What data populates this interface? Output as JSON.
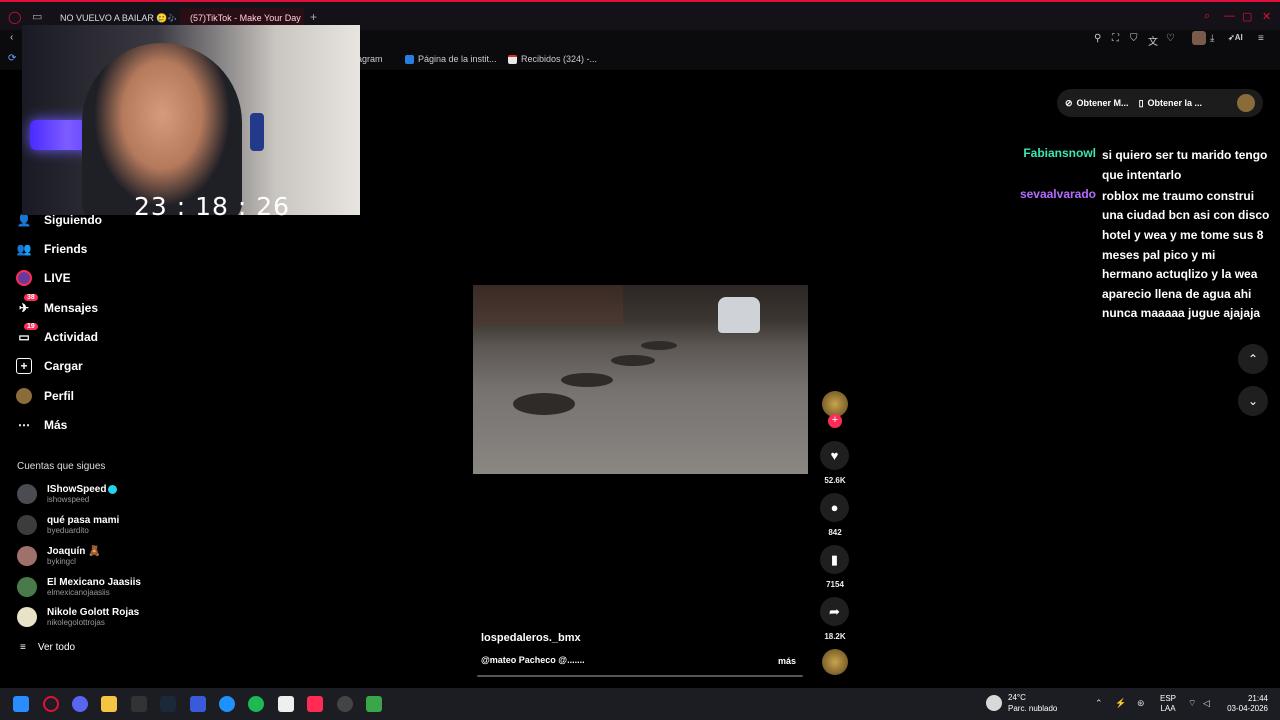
{
  "browser": {
    "tabs": [
      {
        "label": "NO VUELVO A BAILAR 🥲🎶",
        "active": false,
        "icon": "youtube-icon"
      },
      {
        "label": "(57)TikTok - Make Your Day",
        "active": true,
        "icon": "tiktok-icon"
      }
    ],
    "new_tab": "+",
    "bookmarks": [
      {
        "label": "nstagram",
        "icon": "instagram-icon"
      },
      {
        "label": "Página de la instit...",
        "icon": "page-icon"
      },
      {
        "label": "Recibidos (324) -...",
        "icon": "gmail-icon"
      }
    ],
    "toolbar_ai": "AI",
    "accent": "#e0103a"
  },
  "stream": {
    "timer": "23 : 18 : 26"
  },
  "sidebar": {
    "items": [
      {
        "label": "Siguiendo",
        "icon": "following-icon",
        "badge": ""
      },
      {
        "label": "Friends",
        "icon": "friends-icon",
        "badge": ""
      },
      {
        "label": "LIVE",
        "icon": "live-icon",
        "badge": ""
      },
      {
        "label": "Mensajes",
        "icon": "messages-icon",
        "badge": "38"
      },
      {
        "label": "Actividad",
        "icon": "activity-icon",
        "badge": "19"
      },
      {
        "label": "Cargar",
        "icon": "upload-icon",
        "badge": ""
      },
      {
        "label": "Perfil",
        "icon": "profile-icon",
        "badge": ""
      },
      {
        "label": "Más",
        "icon": "more-icon",
        "badge": ""
      }
    ],
    "following_title": "Cuentas que sigues",
    "accounts": [
      {
        "name": "IShowSpeed",
        "user": "ishowspeed",
        "verified": true
      },
      {
        "name": "qué pasa mami",
        "user": "byeduardito",
        "verified": false
      },
      {
        "name": "Joaquín 🧸",
        "user": "bykingcl",
        "verified": false
      },
      {
        "name": "El Mexicano Jaasiis",
        "user": "elmexicanojaasiis",
        "verified": false
      },
      {
        "name": "Nikole Golott Rojas",
        "user": "nikolegolottrojas",
        "verified": false
      }
    ],
    "see_all": "Ver todo"
  },
  "top_buttons": {
    "get_coins": "Obtener M...",
    "get_app": "Obtener la ..."
  },
  "chat": [
    {
      "user": "Fabiansnowl",
      "color": "#3ee6b4",
      "lines": [
        "si quiero ser tu marido tengo",
        "que intentarlo"
      ]
    },
    {
      "user": "sevaalvarado",
      "color": "#b46cff",
      "lines": [
        "roblox me traumo construi",
        "una ciudad bcn asi con disco",
        "hotel y wea y me tome sus 8",
        "meses pal pico y mi",
        "hermano actuqlizo y la wea",
        "aparecio llena de agua ahi",
        "nunca maaaaa jugue ajajaja"
      ]
    }
  ],
  "video": {
    "author": "lospedaleros._bmx",
    "caption": "@mateo Pacheco @.......",
    "more": "más",
    "progress": 0.02,
    "likes": "52.6K",
    "comments": "842",
    "saves": "7154",
    "shares": "18.2K"
  },
  "taskbar": {
    "weather_temp": "24°C",
    "weather_desc": "Parc. nublado",
    "lang_top": "ESP",
    "lang_bottom": "LAA",
    "time": "21:44",
    "date": "03-04-2026"
  }
}
